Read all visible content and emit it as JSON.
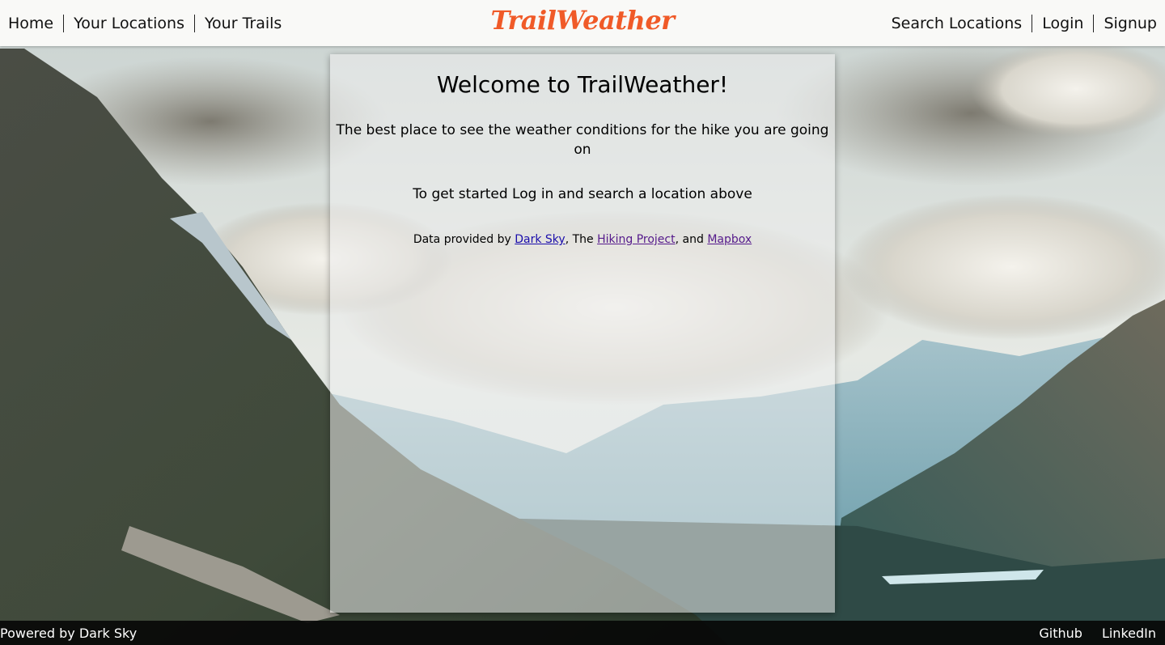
{
  "nav": {
    "left_links": [
      "Home",
      "Your Locations",
      "Your Trails"
    ],
    "right_links": [
      "Search Locations",
      "Login",
      "Signup"
    ]
  },
  "brand": {
    "title": "TrailWeather",
    "color": "#f05a28"
  },
  "main": {
    "title": "Welcome to TrailWeather!",
    "subtitle": "The best place to see the weather conditions for the hike you are going on",
    "instruction": "To get started Log in and search a location above",
    "credits": {
      "prefix": "Data provided by ",
      "link_dark_sky": "Dark Sky",
      "middle": ", The ",
      "link_hiking_project": "Hiking Project",
      "and": ", and ",
      "link_mapbox": "Mapbox"
    }
  },
  "footer": {
    "left_text": "Powered by Dark Sky",
    "right_links": [
      "Github",
      "LinkedIn"
    ]
  },
  "background": {
    "description_icon": "mountain-landscape-image"
  }
}
